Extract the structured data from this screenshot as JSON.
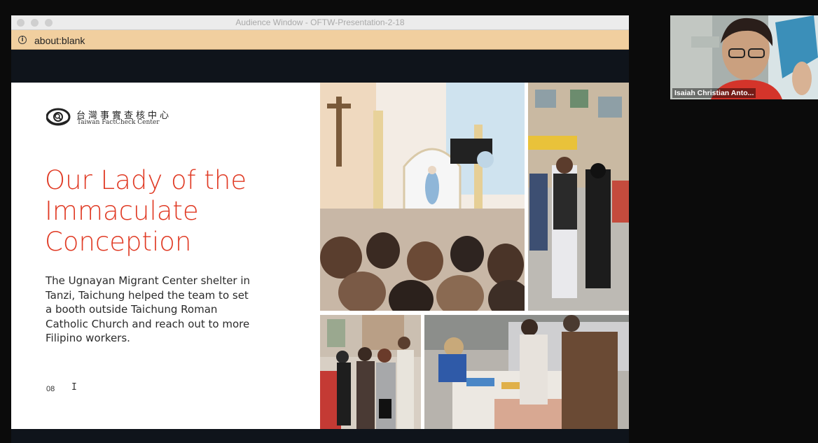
{
  "window": {
    "title": "Audience Window - OFTW-Presentation-2-18",
    "url": "about:blank"
  },
  "slide": {
    "logo_cn": "台灣事實查核中心",
    "logo_en": "Taiwan FactCheck Center",
    "title": "Our Lady of the Immaculate Conception",
    "body": "The Ugnayan Migrant Center shelter in Tanzi, Taichung helped the team to set a booth outside Taichung Roman Catholic Church and reach out to more Filipino workers.",
    "page_number": "08"
  },
  "video": {
    "participant_name": "Isaiah Christian Anto..."
  },
  "colors": {
    "accent_red": "#e03a24",
    "url_bar": "#f1cf9f",
    "stage_bg": "#0f141b"
  },
  "icons": {
    "url_info": "info-icon",
    "cursor": "text-cursor-icon"
  }
}
